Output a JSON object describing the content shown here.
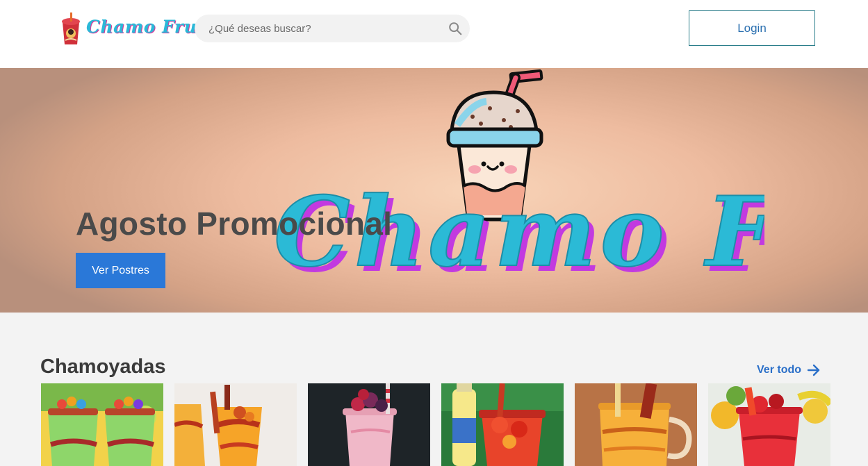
{
  "header": {
    "logo_text": "Chamo Frut",
    "search_placeholder": "¿Qué deseas buscar?",
    "login_label": "Login"
  },
  "hero": {
    "title": "Agosto Promocional",
    "button_label": "Ver Postres",
    "art_text": "Chamo Frut"
  },
  "section": {
    "title": "Chamoyadas",
    "see_all_label": "Ver todo"
  },
  "colors": {
    "brand_cyan": "#2bb8d8",
    "brand_magenta": "#d53c9c",
    "primary_blue": "#2a78d8",
    "link_blue": "#2a6fc8"
  },
  "products": [
    {
      "name": "green-chamoyada"
    },
    {
      "name": "mango-chamoyada"
    },
    {
      "name": "berry-smoothie"
    },
    {
      "name": "strawberry-chamoyada"
    },
    {
      "name": "mango-mug-chamoyada"
    },
    {
      "name": "red-chamoyada"
    }
  ]
}
